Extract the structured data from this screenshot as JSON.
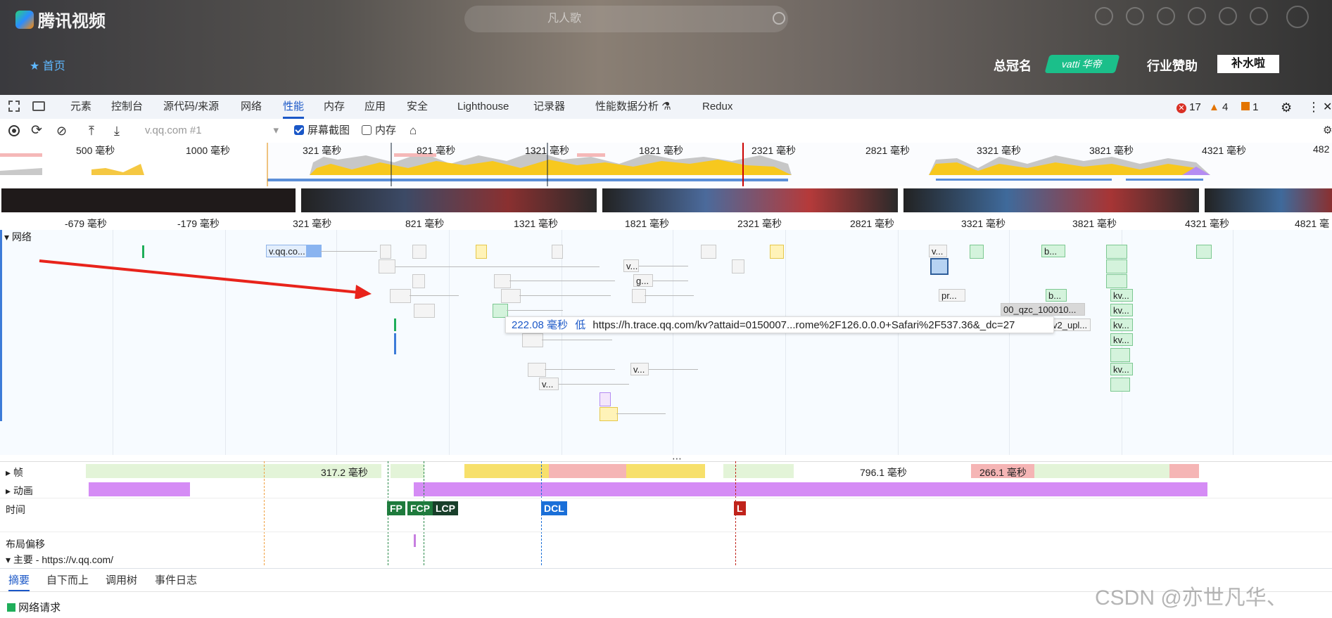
{
  "site": {
    "brand": "腾讯视频",
    "search_placeholder": "凡人歌",
    "nav_home": "首页",
    "sponsor_title": "总冠名",
    "sponsor_vatti": "vatti 华帝",
    "sponsor_industry": "行业赞助",
    "sponsor_shui": "补水啦"
  },
  "devtools": {
    "tabs": [
      "元素",
      "控制台",
      "源代码/来源",
      "网络",
      "性能",
      "内存",
      "应用",
      "安全",
      "Lighthouse",
      "记录器",
      "性能数据分析 ⚗",
      "Redux"
    ],
    "active_tab": "性能",
    "errors": "17",
    "warnings": "4",
    "issues": "1",
    "toolbar": {
      "profile_select": "v.qq.com #1",
      "screenshots_label": "屏幕截图",
      "memory_label": "内存",
      "screenshots_checked": true,
      "memory_checked": false
    },
    "overview_ticks": [
      "500 毫秒",
      "1000 毫秒",
      "321 毫秒",
      "821 毫秒",
      "1321 毫秒",
      "1821 毫秒",
      "2321 毫秒",
      "2821 毫秒",
      "3321 毫秒",
      "3821 毫秒",
      "4321 毫秒",
      "482"
    ],
    "ruler_ticks": [
      "-679 毫秒",
      "-179 毫秒",
      "321 毫秒",
      "821 毫秒",
      "1321 毫秒",
      "1821 毫秒",
      "2321 毫秒",
      "2821 毫秒",
      "3321 毫秒",
      "3821 毫秒",
      "4321 毫秒",
      "4821 毫秒"
    ],
    "network_label": "网络",
    "requests": [
      "v.qq.co...",
      "v...",
      "g...",
      "v...",
      "v...",
      "v...",
      "b...",
      "pr...",
      "b...",
      "00_qzc_100010...",
      "v2_upl...",
      "kv...",
      "kv...",
      "kv...",
      "kv...",
      "kv..."
    ],
    "tooltip": {
      "duration": "222.08 毫秒",
      "priority": "低",
      "url": "https://h.trace.qq.com/kv?attaid=0150007...rome%2F126.0.0.0+Safari%2F537.36&_dc=27"
    },
    "frames_label": "帧",
    "frames_times": [
      "317.2 毫秒",
      "796.1 毫秒",
      "266.1 毫秒"
    ],
    "animation_label": "动画",
    "timings_label": "时间",
    "timing_markers": [
      "FP",
      "FCP",
      "LCP",
      "DCL",
      "L"
    ],
    "layout_shift_label": "布局偏移",
    "main_label": "主要 - https://v.qq.com/",
    "bottom_tabs": [
      "摘要",
      "自下而上",
      "调用树",
      "事件日志"
    ],
    "bottom_active": "摘要",
    "summary_item": "网络请求",
    "watermark": "CSDN @亦世凡华、"
  }
}
